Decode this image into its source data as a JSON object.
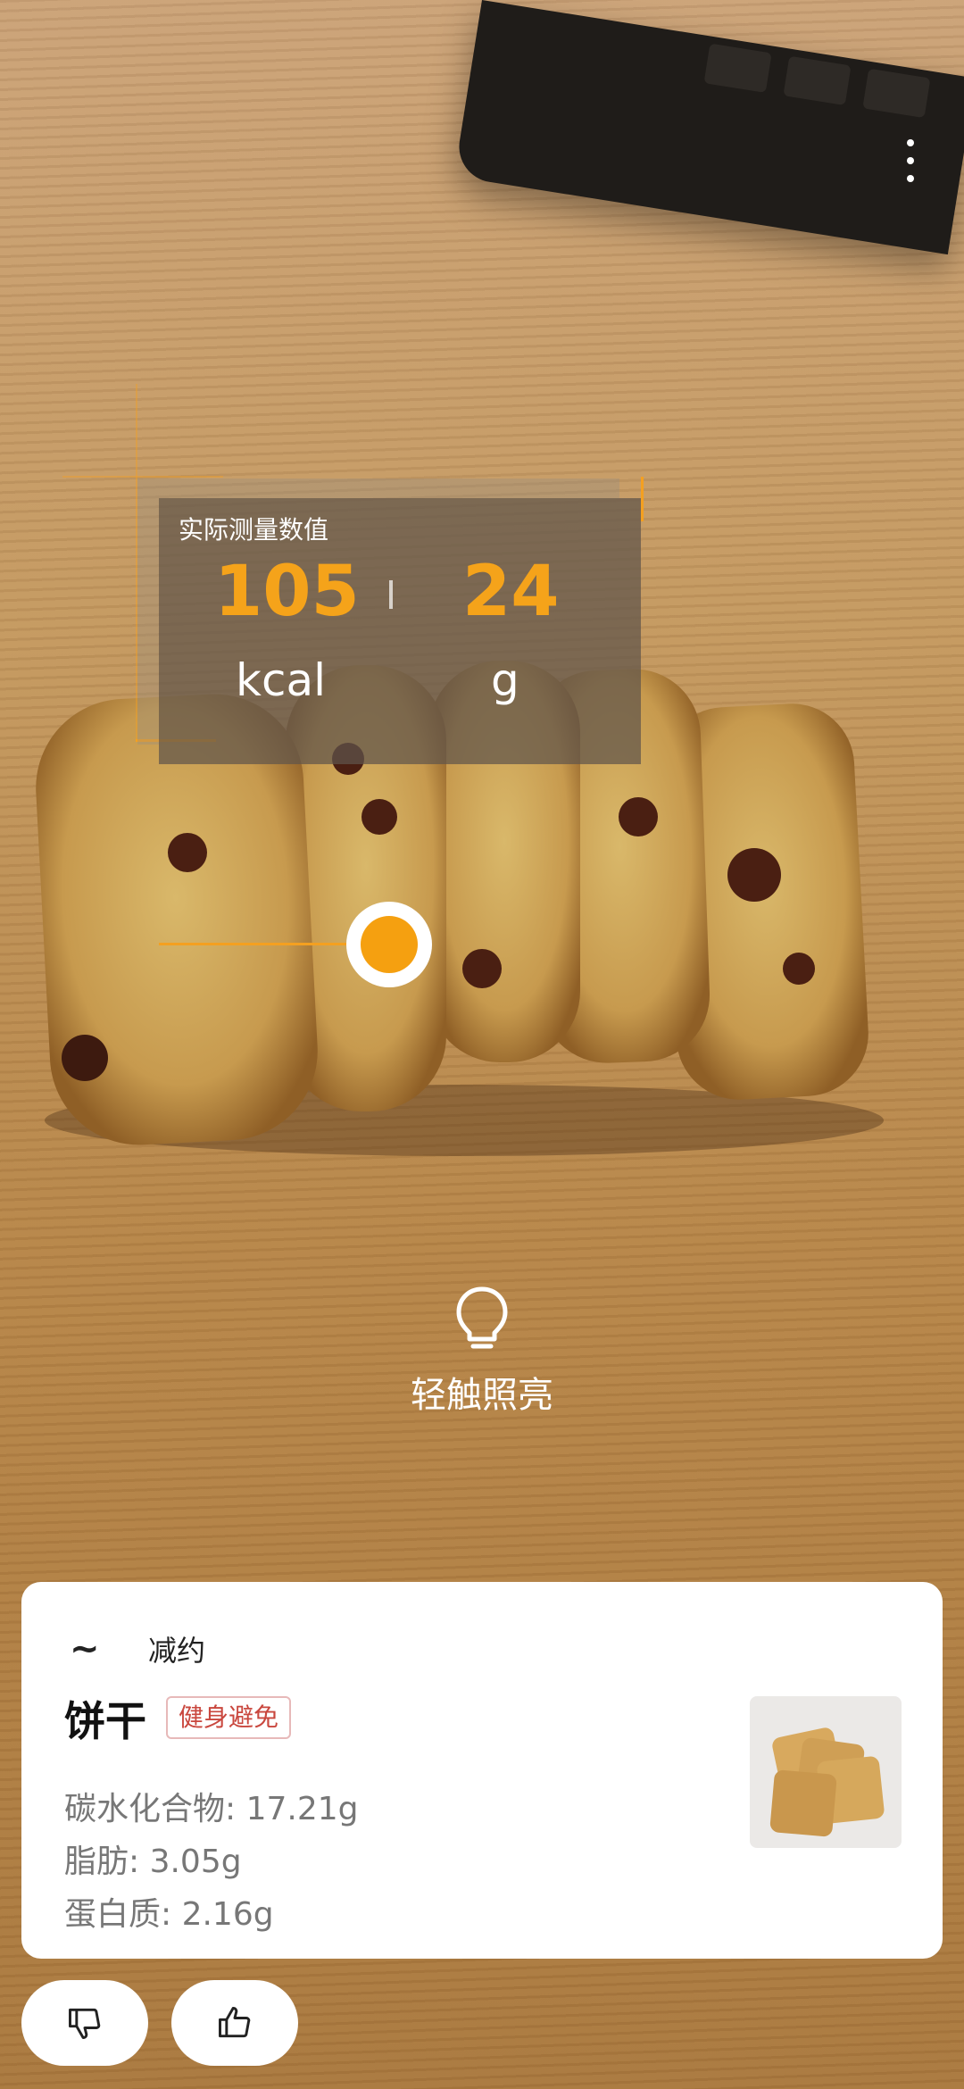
{
  "measurement": {
    "title": "实际测量数值",
    "calories_value": "105",
    "calories_unit": "kcal",
    "weight_value": "24",
    "weight_unit": "g",
    "accent_color": "#F5A31A"
  },
  "camera": {
    "light_label": "轻触照亮",
    "light_icon": "lightbulb-icon",
    "menu_icon": "more-vertical-icon"
  },
  "result_card": {
    "mode_label": "减约",
    "food_name": "饼干",
    "tag": "健身避免",
    "nutrients": [
      "碳水化合物: 17.21g",
      "脂肪: 3.05g",
      "蛋白质: 2.16g"
    ],
    "thumbnail_icon": "biscuit-thumbnail"
  },
  "feedback": {
    "dislike_icon": "thumbs-down-icon",
    "like_icon": "thumbs-up-icon"
  }
}
